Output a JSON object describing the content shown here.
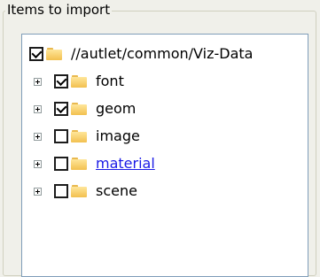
{
  "group": {
    "title": "Items to import"
  },
  "tree": {
    "root": {
      "label": "//autlet/common/Viz-Data",
      "checked": true
    },
    "children": [
      {
        "label": "font",
        "checked": true,
        "expandable": true
      },
      {
        "label": "geom",
        "checked": true,
        "expandable": true
      },
      {
        "label": "image",
        "checked": false,
        "expandable": true
      },
      {
        "label": "material",
        "checked": false,
        "expandable": true,
        "highlighted": true
      },
      {
        "label": "scene",
        "checked": false,
        "expandable": true
      }
    ]
  },
  "icons": {
    "folder": "folder-icon",
    "expander": "plus-expander-icon",
    "checkbox": "checkbox-icon"
  },
  "colors": {
    "link": "#1a1ae6",
    "folder": "#f2c04f",
    "tree_border": "#7f9db9"
  }
}
